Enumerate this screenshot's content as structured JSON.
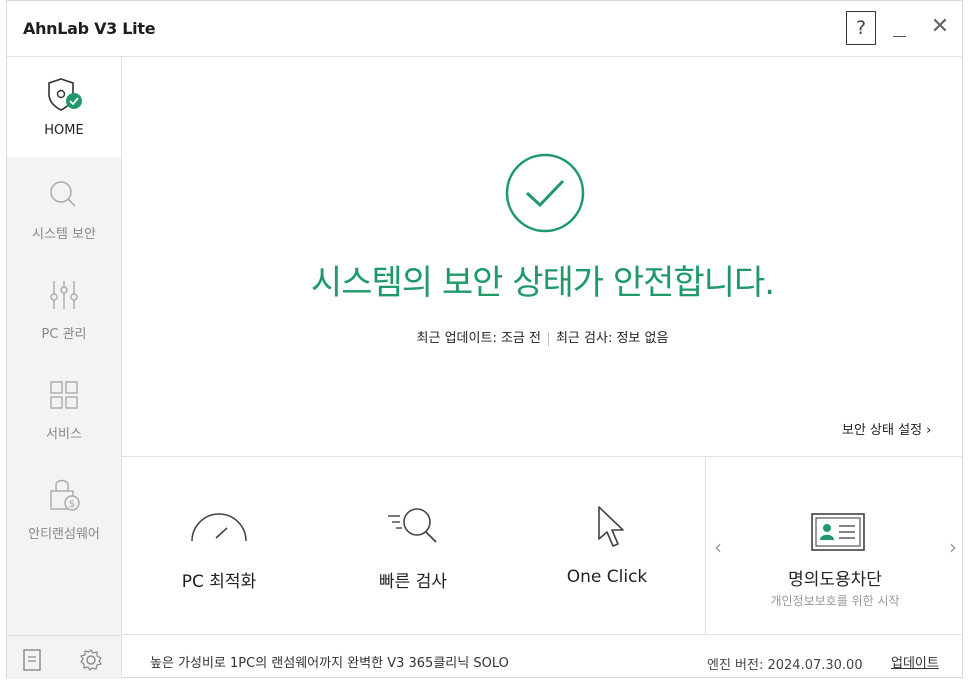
{
  "window": {
    "title": "AhnLab V3 Lite",
    "help": "?",
    "close": "✕"
  },
  "sidebar": {
    "items": [
      {
        "label": "HOME",
        "icon": "shield-check-icon"
      },
      {
        "label": "시스템 보안",
        "icon": "search-icon"
      },
      {
        "label": "PC 관리",
        "icon": "sliders-icon"
      },
      {
        "label": "서비스",
        "icon": "grid-icon"
      },
      {
        "label": "안티랜섬웨어",
        "icon": "lock-dollar-icon"
      }
    ],
    "bottom_icons": [
      "document-icon",
      "gear-icon"
    ]
  },
  "status": {
    "headline": "시스템의 보안 상태가 안전합니다.",
    "update_label": "최근 업데이트: 조금 전",
    "scan_label": "최근 검사: 정보 없음",
    "settings_link": "보안 상태 설정 ›",
    "accent_color": "#1f9968"
  },
  "tiles": [
    {
      "label": "PC 최적화",
      "icon": "gauge-icon"
    },
    {
      "label": "빠른 검사",
      "icon": "quick-scan-icon"
    },
    {
      "label": "One Click",
      "icon": "cursor-icon"
    }
  ],
  "promo": {
    "title": "명의도용차단",
    "subtitle": "개인정보보호를 위한 시작",
    "prev": "‹",
    "next": "›"
  },
  "footer": {
    "promo_text": "높은 가성비로 1PC의 랜섬웨어까지 완벽한 V3 365클리닉 SOLO",
    "engine_version": "엔진 버전: 2024.07.30.00",
    "update_label": "업데이트"
  }
}
